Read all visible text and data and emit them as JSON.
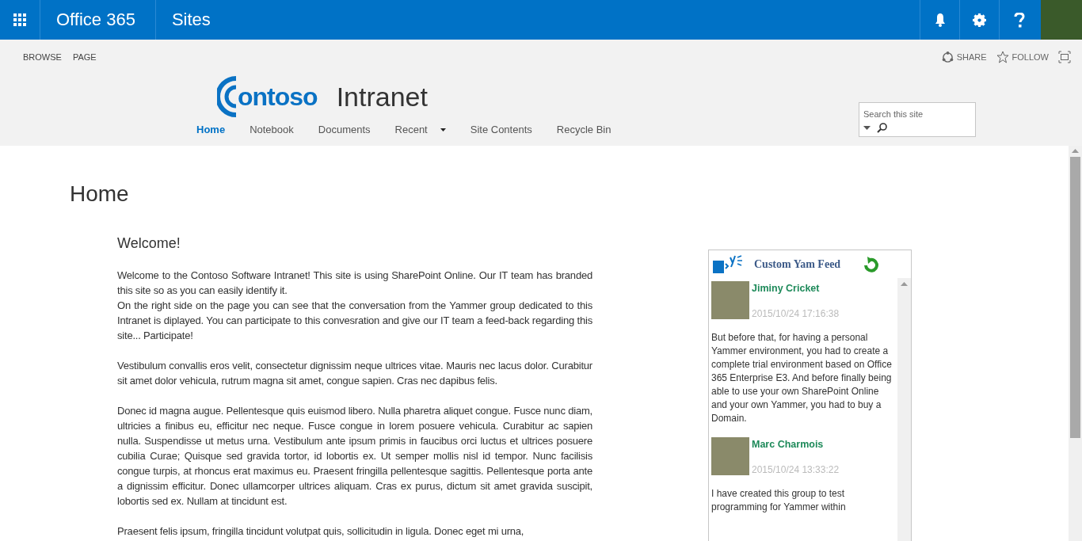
{
  "suite_bar": {
    "app_name": "Office 365",
    "section": "Sites"
  },
  "ribbon": {
    "tabs": [
      {
        "label": "BROWSE"
      },
      {
        "label": "PAGE"
      }
    ],
    "actions": [
      {
        "kind": "share",
        "label": "SHARE"
      },
      {
        "kind": "follow",
        "label": "FOLLOW"
      },
      {
        "kind": "focus"
      }
    ]
  },
  "site": {
    "logo_text": "ontoso",
    "title": "Intranet",
    "nav": [
      {
        "label": "Home",
        "selected": true,
        "dropdown": false
      },
      {
        "label": "Notebook",
        "selected": false,
        "dropdown": false
      },
      {
        "label": "Documents",
        "selected": false,
        "dropdown": false
      },
      {
        "label": "Recent",
        "selected": false,
        "dropdown": true
      },
      {
        "label": "Site Contents",
        "selected": false,
        "dropdown": false
      },
      {
        "label": "Recycle Bin",
        "selected": false,
        "dropdown": false
      }
    ],
    "search": {
      "placeholder": "Search this site"
    }
  },
  "page": {
    "title": "Home",
    "heading": "Welcome!",
    "paragraphs": [
      "Welcome to the Contoso Software Intranet! This site is using SharePoint Online. Our IT team has branded this site so as you can easily identify it.\nOn the right side on the page you can see that the conversation from the Yammer group dedicated to this Intranet is diplayed. You can participate to this convesration and give our IT team a feed-back regarding this site... Participate!",
      "Vestibulum convallis eros velit, consectetur dignissim neque ultrices vitae. Mauris nec lacus dolor. Curabitur sit amet dolor vehicula, rutrum magna sit amet, congue sapien. Cras nec dapibus felis.",
      "Donec id magna augue. Pellentesque quis euismod libero. Nulla pharetra aliquet congue. Fusce nunc diam, ultricies a finibus eu, efficitur nec neque. Fusce congue in lorem posuere vehicula. Curabitur ac sapien nulla. Suspendisse ut metus urna. Vestibulum ante ipsum primis in faucibus orci luctus et ultrices posuere cubilia Curae; Quisque sed gravida tortor, id lobortis ex. Ut semper mollis nisl id tempor. Nunc facilisis congue turpis, at rhoncus erat maximus eu. Praesent fringilla pellentesque sagittis. Pellentesque porta ante a dignissim efficitur. Donec ullamcorper ultrices aliquam. Cras ex purus, dictum sit amet gravida suscipit, lobortis sed ex. Nullam at tincidunt est.",
      "Praesent felis ipsum, fringilla tincidunt volutpat quis, sollicitudin in ligula. Donec eget mi urna,"
    ]
  },
  "feed": {
    "title": "Custom Yam Feed",
    "posts": [
      {
        "author": "Jiminy Cricket",
        "time": "2015/10/24 17:16:38",
        "text": "But before that, for having a personal Yammer environment, you had to create a complete trial environment based on Office 365 Enterprise E3. And before finally being able to use your own SharePoint Online and your own Yammer, you had to buy a Domain."
      },
      {
        "author": "Marc Charmois",
        "time": "2015/10/24 13:33:22",
        "text": "I have created this group to test programming for Yammer within"
      }
    ]
  }
}
